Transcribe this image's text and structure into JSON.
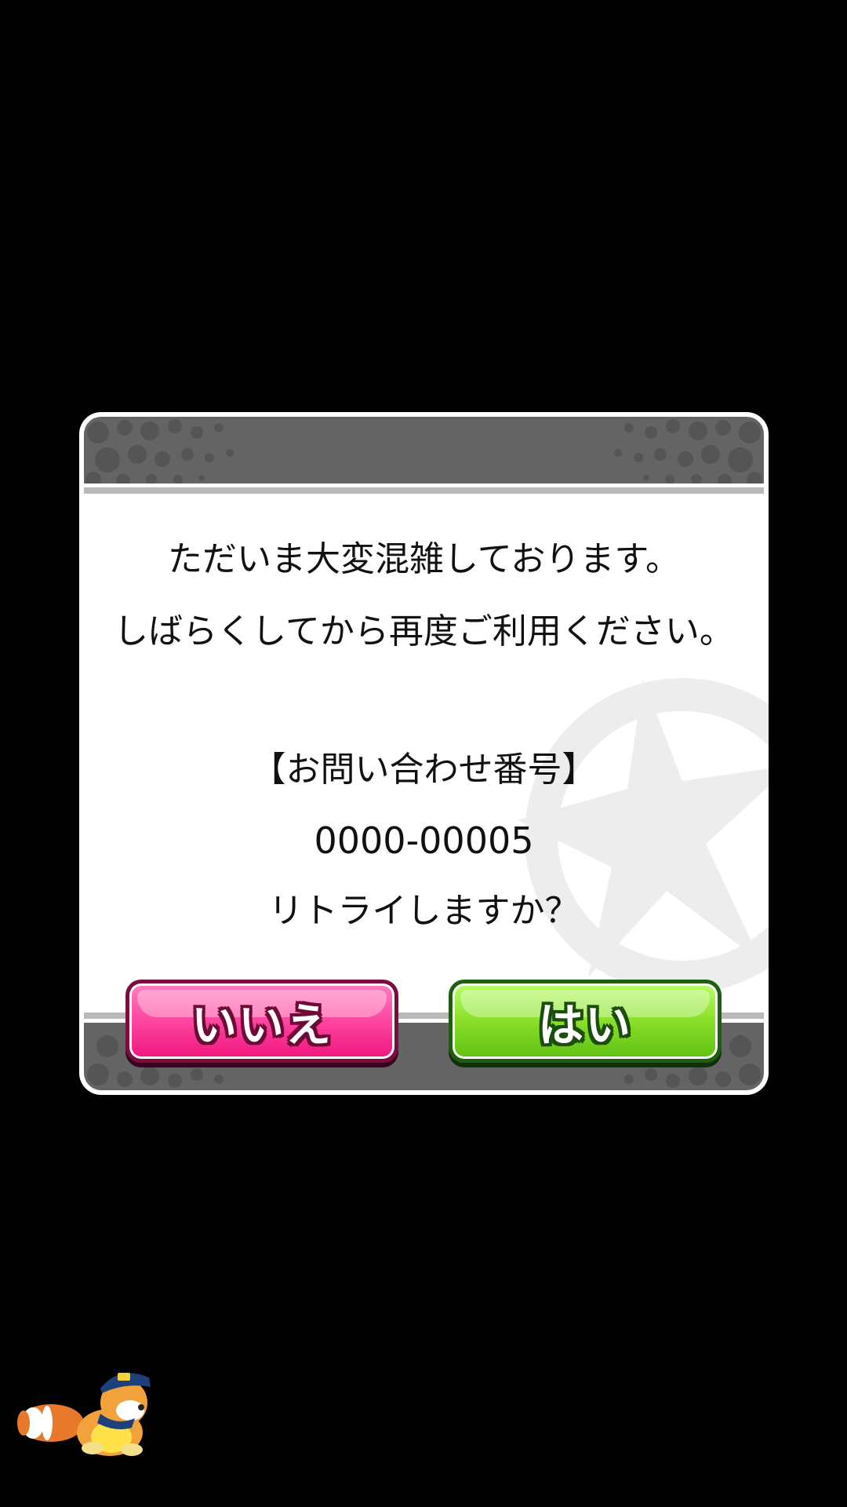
{
  "dialog": {
    "message_line1": "ただいま大変混雑しております。",
    "message_line2": "しばらくしてから再度ご利用ください。",
    "contact_label": "【お問い合わせ番号】",
    "error_code": "0000-00005",
    "retry_question": "リトライしますか？"
  },
  "buttons": {
    "no_label": "いいえ",
    "yes_label": "はい"
  },
  "colors": {
    "background": "#000000",
    "dialog": "#ffffff",
    "band": "#646464",
    "no_button": "#ff4aa3",
    "yes_button": "#8ee22b"
  },
  "icons": {
    "mascot": "raccoon-mascot-icon"
  }
}
